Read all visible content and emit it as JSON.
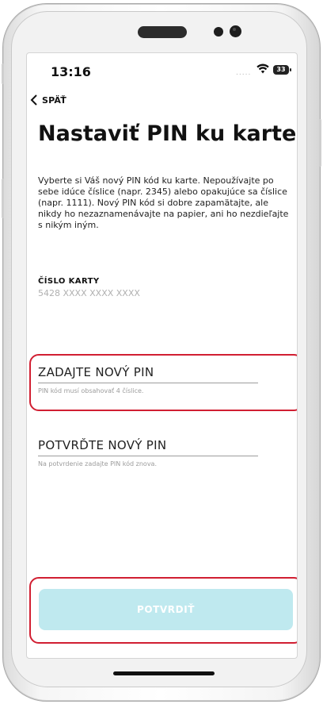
{
  "status_bar": {
    "time": "13:16",
    "signal": ".....",
    "battery": "33"
  },
  "nav": {
    "back_label": "SPÄŤ"
  },
  "page": {
    "title": "Nastaviť PIN ku karte",
    "description": "Vyberte si Váš nový PIN kód ku karte. Nepoužívajte po sebe idúce číslice (napr. 2345) alebo opakujúce sa číslice (napr. 1111). Nový PIN kód si dobre zapamätajte, ale nikdy ho nezaznamenávajte na papier, ani ho nezdieľajte s nikým iným."
  },
  "card": {
    "label": "ČÍSLO KARTY",
    "number": "5428 XXXX XXXX XXXX"
  },
  "fields": {
    "new_pin": {
      "label": "ZADAJTE NOVÝ PIN",
      "hint": "PIN kód musí obsahovať 4 číslice."
    },
    "confirm_pin": {
      "label": "POTVRĎTE NOVÝ PIN",
      "hint": "Na potvrdenie zadajte PIN kód znova."
    }
  },
  "confirm_button": {
    "label": "POTVRDIŤ"
  },
  "colors": {
    "highlight": "#d11f32",
    "button_disabled": "#bfe9ef",
    "text": "#111111",
    "muted": "#9c9c9c"
  }
}
